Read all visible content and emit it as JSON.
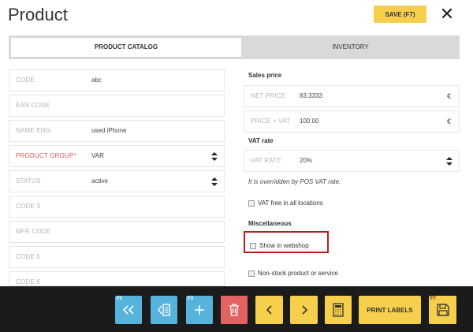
{
  "header": {
    "title": "Product",
    "save_label": "SAVE (F7)",
    "close_icon": "close-icon"
  },
  "tabs": [
    {
      "label": "PRODUCT CATALOG",
      "active": true
    },
    {
      "label": "INVENTORY",
      "active": false
    }
  ],
  "left_fields": [
    {
      "label": "CODE",
      "value": "abc",
      "required": false,
      "type": "text"
    },
    {
      "label": "EAN CODE",
      "value": "",
      "required": false,
      "type": "text"
    },
    {
      "label": "NAME ENG",
      "value": "used iPhone",
      "required": false,
      "type": "text"
    },
    {
      "label": "PRODUCT GROUP*",
      "value": "VAR",
      "required": true,
      "type": "select"
    },
    {
      "label": "STATUS",
      "value": "active",
      "required": false,
      "type": "select"
    },
    {
      "label": "CODE 3",
      "value": "",
      "required": false,
      "type": "text"
    },
    {
      "label": "MFR CODE",
      "value": "",
      "required": false,
      "type": "text"
    },
    {
      "label": "CODE 5",
      "value": "",
      "required": false,
      "type": "text"
    },
    {
      "label": "CODE 6",
      "value": "",
      "required": false,
      "type": "text"
    }
  ],
  "sales_price": {
    "heading": "Sales price",
    "net_label": "NET PRICE",
    "net_value": "83.3333",
    "net_currency": "€",
    "vat_label": "PRICE + VAT",
    "vat_value": "100.00",
    "vat_currency": "€"
  },
  "vat_rate": {
    "heading": "VAT rate",
    "label": "VAT RATE",
    "value": "20%",
    "note": "It is overridden by POS VAT rate.",
    "vat_free_label": "VAT free in all locations"
  },
  "misc": {
    "heading": "Miscellaneous",
    "show_in_webshop": "Show in webshop",
    "non_stock": "Non-stock product or service"
  },
  "toolbar": {
    "f2_key": "F2",
    "f3_key": "F3",
    "f7_key": "F7",
    "print_labels": "PRINT LABELS",
    "colors": {
      "blue": "#56b3dc",
      "red": "#e36363",
      "yellow": "#f6d04d",
      "bar": "#1b1b1b"
    }
  }
}
